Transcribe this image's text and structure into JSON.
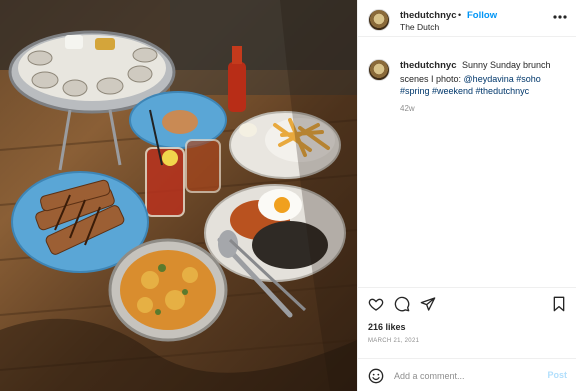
{
  "post": {
    "username": "thedutchnyc",
    "follow_label": "Follow",
    "separator": "•",
    "location": "The Dutch",
    "caption_text": "Sunny Sunday brunch scenes I photo: ",
    "caption_mention": "@heydavina",
    "caption_hashtags": "#soho #spring #weekend #thedutchnyc",
    "time_ago": "42w",
    "likes": "216 likes",
    "date": "MARCH 21, 2021"
  },
  "comment": {
    "placeholder": "Add a comment...",
    "post_label": "Post"
  },
  "colors": {
    "link": "#00376b",
    "follow": "#0095f6",
    "post_disabled": "#b2dffc",
    "table": "#8a5f36",
    "plate_blue": "#5aa6d6"
  },
  "icons": [
    "more-options-icon",
    "heart-icon",
    "comment-icon",
    "share-icon",
    "bookmark-icon",
    "emoji-icon"
  ]
}
